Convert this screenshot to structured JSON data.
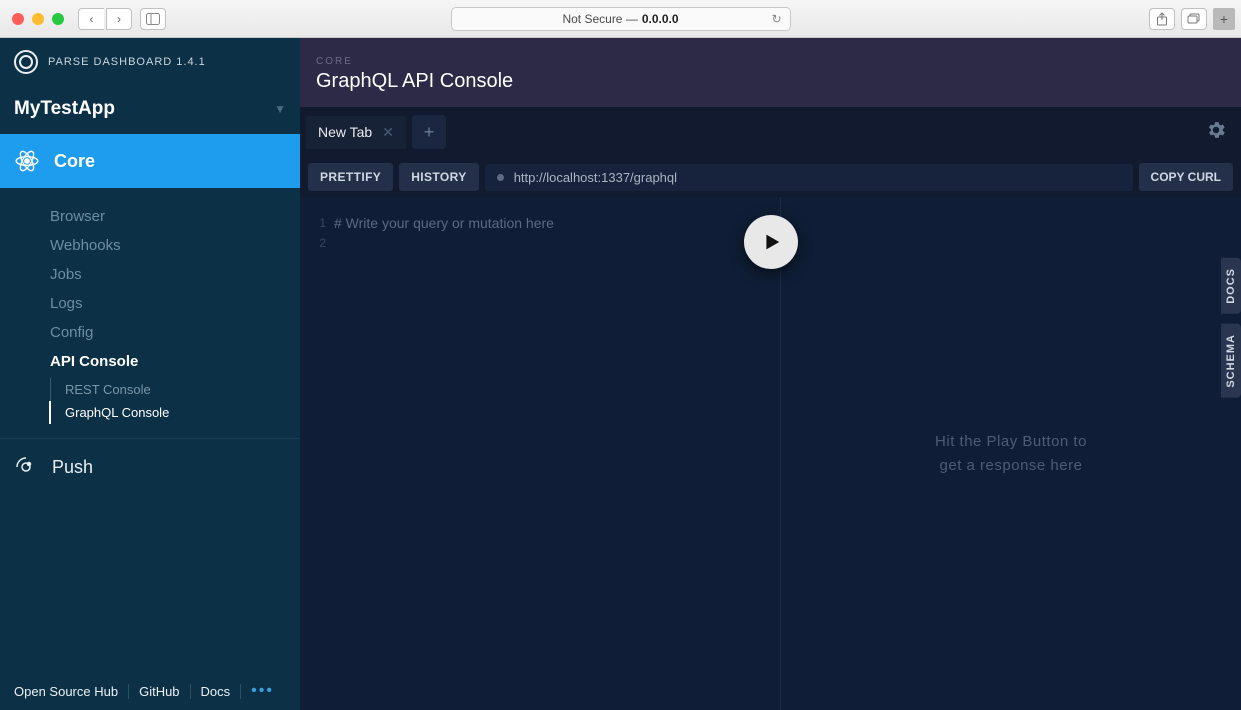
{
  "browser": {
    "security_label": "Not Secure —",
    "address": "0.0.0.0"
  },
  "sidebar": {
    "brand": "PARSE DASHBOARD 1.4.1",
    "app_name": "MyTestApp",
    "section_core": "Core",
    "nav": [
      {
        "label": "Browser"
      },
      {
        "label": "Webhooks"
      },
      {
        "label": "Jobs"
      },
      {
        "label": "Logs"
      },
      {
        "label": "Config"
      },
      {
        "label": "API Console",
        "active": true,
        "sub": [
          {
            "label": "REST Console"
          },
          {
            "label": "GraphQL Console",
            "selected": true
          }
        ]
      }
    ],
    "section_push": "Push",
    "footer": {
      "links": [
        "Open Source Hub",
        "GitHub",
        "Docs"
      ]
    }
  },
  "header": {
    "crumb": "CORE",
    "title": "GraphQL API Console"
  },
  "tabs": {
    "active": "New Tab"
  },
  "toolbar": {
    "prettify": "PRETTIFY",
    "history": "HISTORY",
    "endpoint": "http://localhost:1337/graphql",
    "copy": "COPY CURL"
  },
  "editor": {
    "lines": [
      "1",
      "2"
    ],
    "placeholder": "# Write your query or mutation here"
  },
  "results": {
    "placeholder_line1": "Hit the Play Button to",
    "placeholder_line2": "get a response here"
  },
  "side_tabs": {
    "docs": "DOCS",
    "schema": "SCHEMA"
  }
}
